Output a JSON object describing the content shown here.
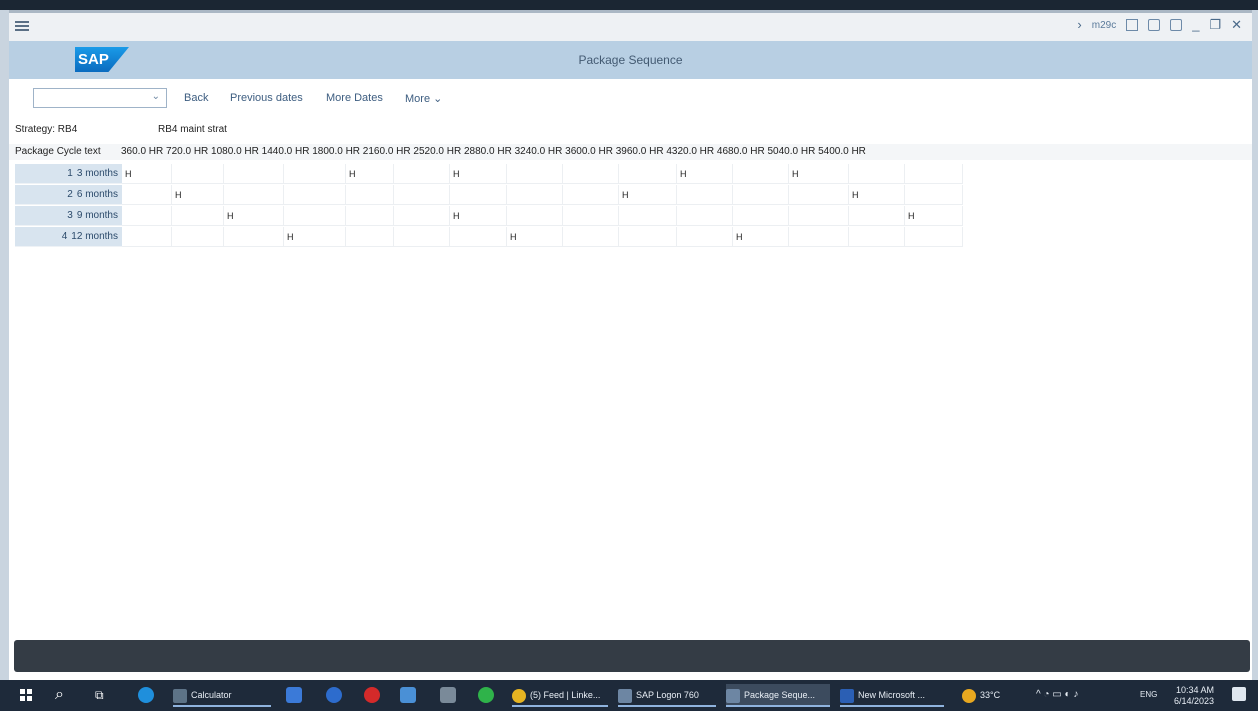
{
  "window": {
    "title": "Package Sequence",
    "transaction_code": "m29c",
    "logo_text": "SAP"
  },
  "toolbar": {
    "back_label": "Back",
    "previous_dates_label": "Previous dates",
    "more_dates_label": "More Dates",
    "more_label": "More"
  },
  "strategy": {
    "label": "Strategy: RB4",
    "description": "RB4 maint strat"
  },
  "package_cycle": {
    "label": "Package Cycle text",
    "values_text": "360.0 HR 720.0 HR 1080.0 HR 1440.0 HR 1800.0 HR 2160.0 HR 2520.0 HR 2880.0 HR 3240.0 HR 3600.0 HR 3960.0 HR 4320.0 HR 4680.0 HR 5040.0 HR 5400.0 HR"
  },
  "packages": [
    {
      "num": "1",
      "text": "3 months",
      "marks": [
        "H",
        "",
        "",
        "",
        "H",
        "",
        "H",
        "",
        "",
        "",
        "H",
        "",
        "H",
        "",
        ""
      ]
    },
    {
      "num": "2",
      "text": "6 months",
      "marks": [
        "",
        "H",
        "",
        "",
        "",
        "",
        "",
        "",
        "",
        "H",
        "",
        "",
        "",
        "H",
        ""
      ]
    },
    {
      "num": "3",
      "text": "9 months",
      "marks": [
        "",
        "",
        "H",
        "",
        "",
        "",
        "H",
        "",
        "",
        "",
        "",
        "",
        "",
        "",
        "H"
      ]
    },
    {
      "num": "4",
      "text": "12 months",
      "marks": [
        "",
        "",
        "",
        "H",
        "",
        "",
        "",
        "H",
        "",
        "",
        "",
        "H",
        "",
        "",
        ""
      ]
    }
  ],
  "taskbar": {
    "apps": [
      "Calculator",
      "(5) Feed | Linke...",
      "SAP Logon 760",
      "Package Seque...",
      "New Microsoft ..."
    ],
    "weather": "33°C",
    "lang": "ENG",
    "time": "10:34 AM",
    "date": "6/14/2023"
  }
}
